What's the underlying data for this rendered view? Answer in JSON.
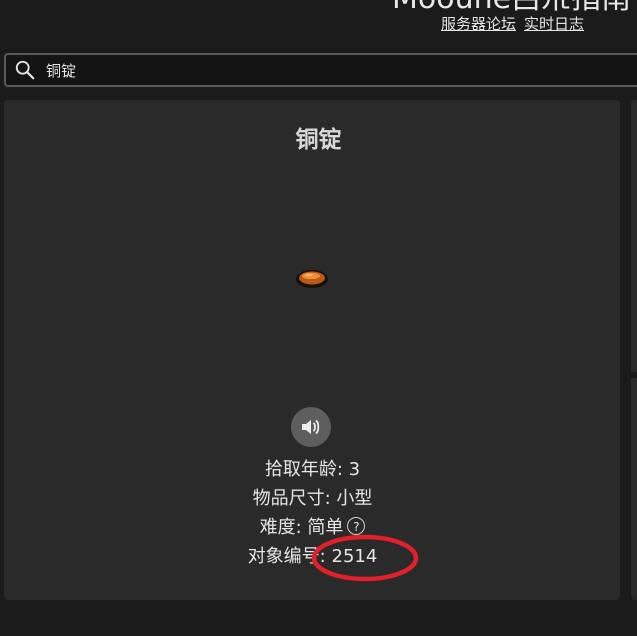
{
  "header": {
    "site_title": "Mooune吕朮指南",
    "links": [
      "服务器论坛",
      "实时日志"
    ]
  },
  "search": {
    "value": "铜锭",
    "icon": "search-icon"
  },
  "item": {
    "title": "铜锭",
    "image": "copper-ingot-icon",
    "sound_icon": "speaker-icon",
    "pickup_age_label": "拾取年龄:",
    "pickup_age": "3",
    "size_label": "物品尺寸:",
    "size": "小型",
    "difficulty_label": "难度:",
    "difficulty": "简单",
    "help": "?",
    "object_id_label": "对象编号:",
    "object_id": "2514"
  },
  "colors": {
    "background": "#1b1b1b",
    "card": "#2a2a2a",
    "annotation": "#e0202a"
  }
}
